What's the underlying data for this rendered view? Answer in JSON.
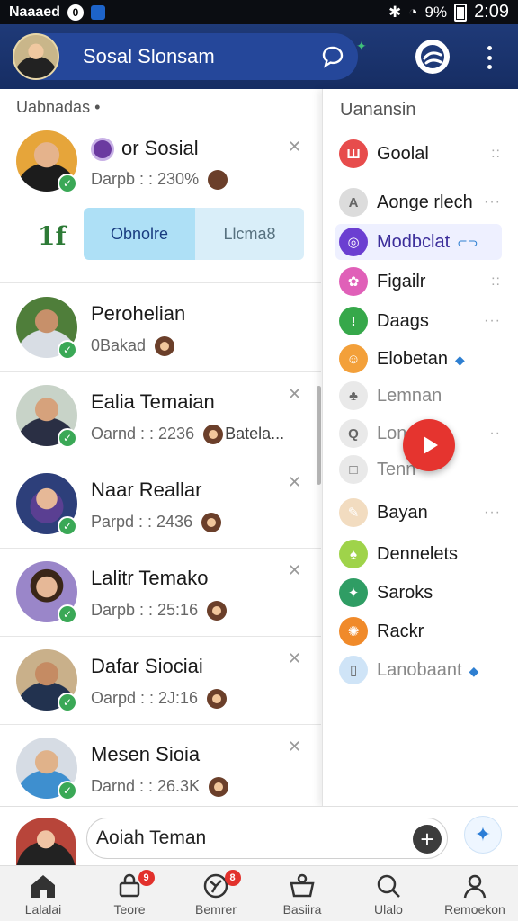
{
  "status_bar": {
    "app_text": "Naaaed",
    "chip1": "0",
    "battery": "9%",
    "time": "2:09"
  },
  "app_bar": {
    "title": "Sosal Slonsam",
    "icons": [
      "chat-bubble-icon",
      "logo-icon",
      "more-vert-icon"
    ]
  },
  "left": {
    "section_label": "Uabnadas •",
    "first": {
      "name": "or Sosial",
      "sub": "Darpb : : 230%",
      "count": "1f",
      "primary_button": "Obnolre",
      "secondary_button": "Llcma8"
    },
    "items": [
      {
        "name": "Perohelian",
        "sub": "0Bakad",
        "extra": ""
      },
      {
        "name": "Ealia Temaian",
        "sub": "Oarnd : : 2236",
        "extra": "Batela..."
      },
      {
        "name": "Naar Reallar",
        "sub": "Parpd : : 2436",
        "extra": ""
      },
      {
        "name": "Lalitr Temako",
        "sub": "Darpb : : 25:16",
        "extra": ""
      },
      {
        "name": "Dafar Siociai",
        "sub": "Oarpd : : 2J:16",
        "extra": ""
      },
      {
        "name": "Mesen Sioia",
        "sub": "Darnd : : 26.3K",
        "extra": ""
      }
    ]
  },
  "drawer": {
    "title": "Uanansin",
    "items": [
      {
        "label": "Goolal",
        "color": "#e74c4c",
        "glyph": "Ш",
        "more": "::",
        "muted": false
      },
      {
        "label": "Aonge rlech",
        "color": "#dcdcdc",
        "glyph": "A",
        "more": "···",
        "muted": false
      },
      {
        "label": "Modbclat",
        "color": "#6b3fd1",
        "glyph": "◎",
        "more": "",
        "muted": false
      },
      {
        "label": "Figailr",
        "color": "#e060b8",
        "glyph": "✿",
        "more": "::",
        "muted": false
      },
      {
        "label": "Daags",
        "color": "#36a84a",
        "glyph": "!",
        "more": "···",
        "muted": false
      },
      {
        "label": "Elobetan",
        "color": "#f3a03a",
        "glyph": "☺",
        "more": "",
        "muted": false
      },
      {
        "label": "Lemnan",
        "color": "#e9e9e9",
        "glyph": "♣",
        "more": "",
        "muted": true
      },
      {
        "label": "Lon",
        "color": "#e9e9e9",
        "glyph": "Q",
        "more": "··",
        "muted": true
      },
      {
        "label": "Tenn",
        "color": "#e9e9e9",
        "glyph": "□",
        "more": "",
        "muted": true
      },
      {
        "label": "Bayan",
        "color": "#f2dcc0",
        "glyph": "✎",
        "more": "···",
        "muted": false
      },
      {
        "label": "Dennelets",
        "color": "#9fd34a",
        "glyph": "♠",
        "more": "",
        "muted": false
      },
      {
        "label": "Saroks",
        "color": "#2f9d64",
        "glyph": "✦",
        "more": "",
        "muted": false
      },
      {
        "label": "Rackr",
        "color": "#f08a2a",
        "glyph": "✺",
        "more": "",
        "muted": false
      },
      {
        "label": "Lanobaant",
        "color": "#cfe4f7",
        "glyph": "▯",
        "more": "",
        "muted": true
      }
    ]
  },
  "composer": {
    "text": "Aoiah Teman"
  },
  "bottom_nav": [
    {
      "label": "Lalalai",
      "icon": "home-icon",
      "badge": ""
    },
    {
      "label": "Teore",
      "icon": "lock-icon",
      "badge": "9"
    },
    {
      "label": "Bemrer",
      "icon": "clock-icon",
      "badge": "8"
    },
    {
      "label": "Basiira",
      "icon": "basket-icon",
      "badge": ""
    },
    {
      "label": "Ulalo",
      "icon": "search-icon",
      "badge": ""
    },
    {
      "label": "Remoekon",
      "icon": "person-icon",
      "badge": ""
    }
  ]
}
